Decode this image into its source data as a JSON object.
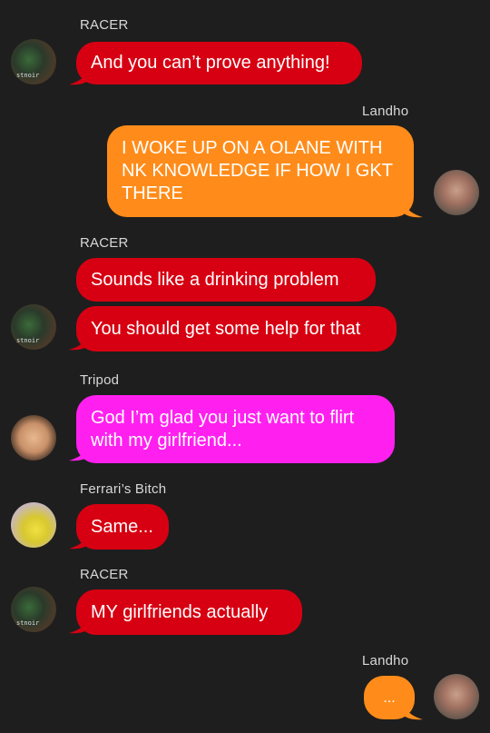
{
  "colors": {
    "background": "#1e1e1e",
    "red_bubble": "#d70012",
    "orange_bubble": "#ff8c1a",
    "magenta_bubble": "#ff20f0",
    "name_text": "#d8d8d8"
  },
  "messages": [
    {
      "sender": "RACER",
      "text": "And you can’t prove anything!"
    },
    {
      "sender": "Landho",
      "lines": [
        "I WOKE UP ON A OLANE WITH",
        "NK KNOWLEDGE IF HOW I GKT",
        "THERE"
      ]
    },
    {
      "sender": "RACER",
      "text_1": "Sounds like a drinking problem",
      "text_2": "You should get some help for that"
    },
    {
      "sender": "Tripod",
      "lines": [
        "God I’m glad you just want to flirt",
        "with my girlfriend..."
      ]
    },
    {
      "sender": "Ferrari’s Bitch",
      "text": "Same..."
    },
    {
      "sender": "RACER",
      "text": "MY girlfriends actually"
    },
    {
      "sender": "Landho",
      "text": "...",
      "typing": true
    }
  ],
  "avatars": {
    "racer_tag": "stnoir"
  }
}
